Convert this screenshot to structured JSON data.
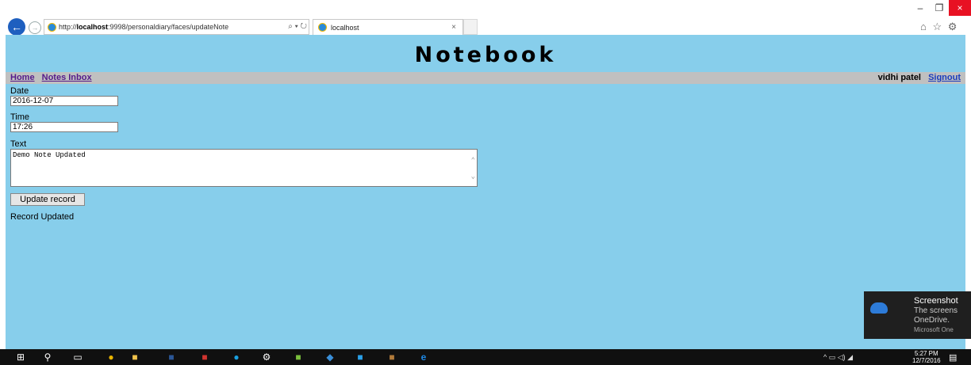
{
  "browser": {
    "url_prefix": "http://",
    "url_host": "localhost",
    "url_rest": ":9998/personaldiary/faces/updateNote",
    "addr_controls": "⌕ ▾ ↻",
    "tab_title": "localhost",
    "tab_close": "×",
    "window_minimize": "–",
    "window_maximize": "❐",
    "window_close": "×",
    "toolbar_icons": "⌂ ☆ ⚙ ☺"
  },
  "page": {
    "title": "Notebook",
    "nav": {
      "home": "Home",
      "notes_inbox": "Notes Inbox",
      "user_name": "vidhi patel",
      "signout": "Signout"
    },
    "form": {
      "date_label": "Date",
      "date_value": "2016-12-07",
      "time_label": "Time",
      "time_value": "17:26",
      "text_label": "Text",
      "text_value": "Demo Note Updated",
      "update_button": "Update record"
    },
    "status_message": "Record Updated"
  },
  "toast": {
    "title": "Screenshot",
    "body_line1": "The screens",
    "body_line2": "OneDrive.",
    "source": "Microsoft One"
  },
  "taskbar": {
    "tray": "^ ▭ ◁) ◢",
    "time": "5:27 PM",
    "date": "12/7/2016"
  },
  "colors": {
    "page_background": "#87ceeb",
    "navbar": "#c0c0c0",
    "link": "#551a8b",
    "signout_link": "#1a3cbd",
    "close_button": "#e81123"
  }
}
